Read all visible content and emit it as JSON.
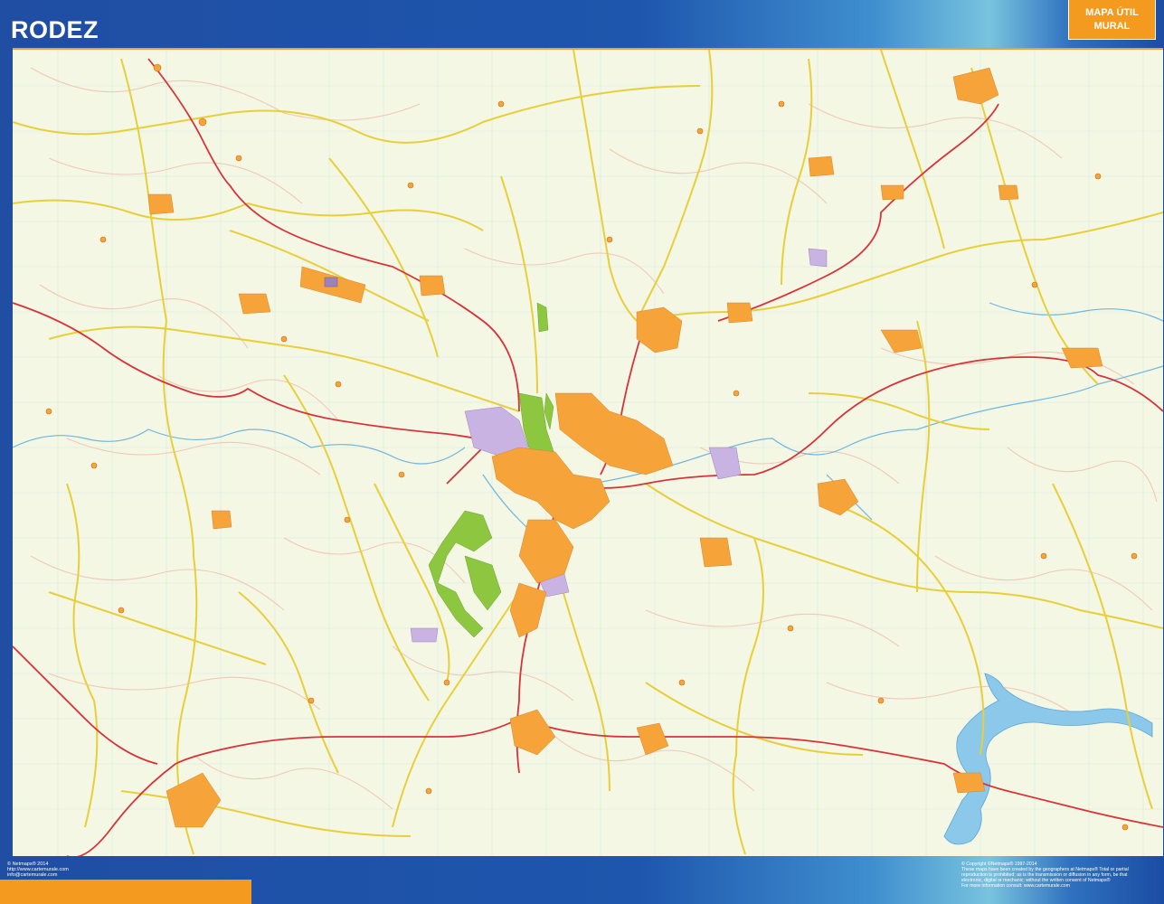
{
  "map": {
    "title": "RODEZ",
    "badge": {
      "line1": "MAPA ÚTIL",
      "line2": "MURAL"
    },
    "colors": {
      "background": "#f3f7e4",
      "urban": "#f6a33a",
      "industrial": "#c9b3e3",
      "park": "#8dc63f",
      "water": "#7fc1e8",
      "main_road": "#d9333a",
      "secondary_road": "#e8cf3a",
      "minor_road": "#f3c9b8",
      "frame": "#1e56ad",
      "accent": "#f39a1f"
    },
    "icons": [
      "place-marker-icon",
      "aerodrome-icon"
    ]
  },
  "footer": {
    "left": {
      "copyright": "© Netmaps® 2014",
      "website": "http://www.cartemurale.com",
      "email": "info@cartemurale.com"
    },
    "right": {
      "line1": "© Copyright ©Netmaps® 1997-2014",
      "line2": "These maps have been created by the geographers at Netmaps® Total or partial",
      "line3": "reproduction is prohibited; as is the transmission or diffusion in any form, be that",
      "line4": "electronic, digital or mechanic; without the written consent of Netmaps®",
      "line5": "For more information consult: www.cartemurale.com"
    }
  }
}
